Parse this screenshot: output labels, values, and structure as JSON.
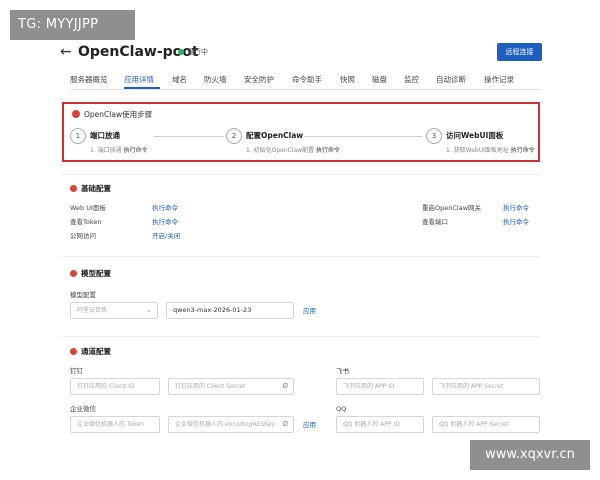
{
  "watermarks": {
    "top_left": "TG: MYYJJPP",
    "bottom_right": "www.xqxvr.cn"
  },
  "header": {
    "title": "OpenClaw-poot",
    "status": "运行中",
    "remote_button": "远程连接"
  },
  "tabs": [
    {
      "label": "服务器概览",
      "active": false
    },
    {
      "label": "应用详情",
      "active": true
    },
    {
      "label": "域名",
      "active": false
    },
    {
      "label": "防火墙",
      "active": false
    },
    {
      "label": "安全防护",
      "active": false
    },
    {
      "label": "命令助手",
      "active": false
    },
    {
      "label": "快照",
      "active": false
    },
    {
      "label": "磁盘",
      "active": false
    },
    {
      "label": "监控",
      "active": false
    },
    {
      "label": "自动诊断",
      "active": false
    },
    {
      "label": "操作记录",
      "active": false
    }
  ],
  "steps": {
    "title": "OpenClaw使用步骤",
    "items": [
      {
        "num": "1",
        "title": "端口放通",
        "desc": "1. 端口放通",
        "link": "执行命令"
      },
      {
        "num": "2",
        "title": "配置OpenClaw",
        "desc": "1. 初始化OpenClaw配置",
        "link": "执行命令"
      },
      {
        "num": "3",
        "title": "访问WebUI面板",
        "desc": "1. 获取WebUI面板地址",
        "link": "执行命令"
      }
    ]
  },
  "basic": {
    "title": "基础配置",
    "webui_label": "Web UI面板",
    "webui_link": "执行命令",
    "token_label": "查看Token",
    "token_link": "执行命令",
    "public_label": "公网访问",
    "public_link": "开启/关闭",
    "restart_label": "重启OpenClaw网关",
    "restart_link": "执行命令",
    "port_label": "查看端口",
    "port_link": "执行命令"
  },
  "model": {
    "title": "模型配置",
    "label": "模型配置",
    "provider_value": "阿里云百炼",
    "model_value": "qwen3-max-2026-01-23",
    "apply": "应用"
  },
  "channel": {
    "title": "通道配置",
    "dingtalk_label": "钉钉",
    "dingtalk_id_ph": "钉钉应用的 Client ID",
    "dingtalk_secret_ph": "钉钉应用的 Client Secret",
    "feishu_label": "飞书",
    "feishu_id_ph": "飞书应用的 APP ID",
    "feishu_secret_ph": "飞书应用的 APP Secret",
    "wecom_label": "企业微信",
    "wecom_token_ph": "企业微信机器人的 Token",
    "wecom_key_ph": "企业微信机器人的 encodingAESKey",
    "wecom_apply": "应用",
    "qq_label": "QQ",
    "qq_id_ph": "QQ 机器人的 APP ID",
    "qq_secret_ph": "QQ 机器人的 APP Secret"
  }
}
